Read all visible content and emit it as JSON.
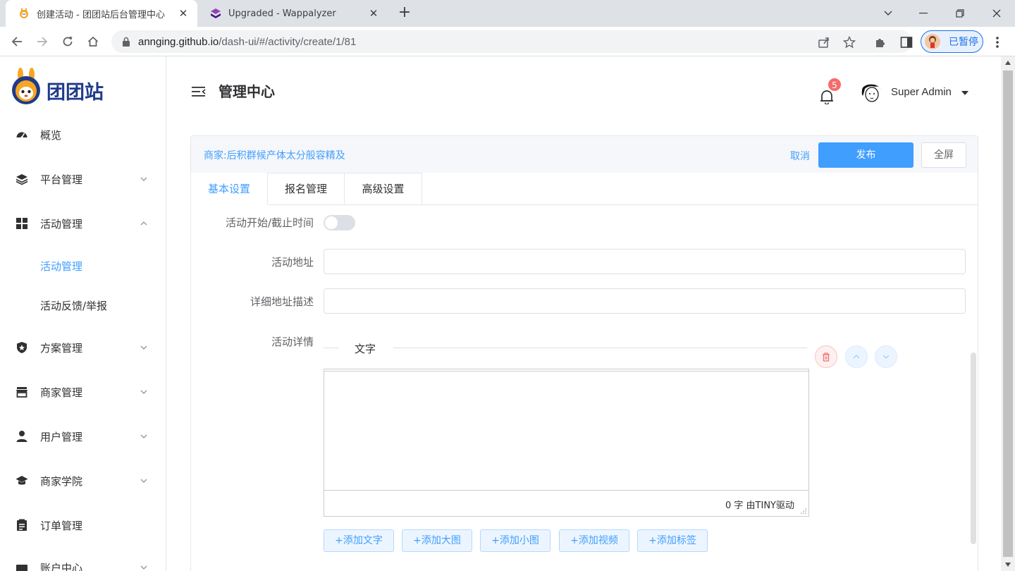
{
  "browser": {
    "tabs": [
      {
        "title": "创建活动 - 团团站后台管理中心",
        "active": true
      },
      {
        "title": "Upgraded - Wappalyzer",
        "active": false
      }
    ],
    "url_host": "annging.github.io",
    "url_path": "/dash-ui/#/activity/create/1/81",
    "profile_label": "已暂停",
    "accent": "#1a73e8"
  },
  "sidebar": {
    "logo_text": "团团站",
    "items": [
      {
        "label": "概览",
        "icon": "dashboard-icon",
        "expandable": false
      },
      {
        "label": "平台管理",
        "icon": "layers-icon",
        "expandable": true
      },
      {
        "label": "活动管理",
        "icon": "grid-icon",
        "expandable": true,
        "expanded": true
      },
      {
        "label": "活动管理",
        "sub": true,
        "active": true
      },
      {
        "label": "活动反馈/举报",
        "sub": true
      },
      {
        "label": "方案管理",
        "icon": "shield-icon",
        "expandable": true
      },
      {
        "label": "商家管理",
        "icon": "store-icon",
        "expandable": true
      },
      {
        "label": "用户管理",
        "icon": "user-icon",
        "expandable": true
      },
      {
        "label": "商家学院",
        "icon": "graduation-cap-icon",
        "expandable": true
      },
      {
        "label": "订单管理",
        "icon": "clipboard-icon",
        "expandable": false
      },
      {
        "label": "账户中心",
        "icon": "account-icon",
        "expandable": true
      }
    ]
  },
  "header": {
    "title": "管理中心",
    "notification_count": "5",
    "user_name": "Super Admin"
  },
  "card": {
    "merchant": "商家:后积群候产体太分般容精及",
    "cancel": "取消",
    "publish": "发布",
    "fullscreen": "全屏",
    "tabs": [
      "基本设置",
      "报名管理",
      "高级设置"
    ],
    "active_tab": 0
  },
  "form": {
    "time_label": "活动开始/截止时间",
    "time_switch_on": false,
    "address_label": "活动地址",
    "address_value": "",
    "detail_address_label": "详细地址描述",
    "detail_address_value": "",
    "details_label": "活动详情",
    "section_title": "文字",
    "editor_status": "0 字 由TINY驱动",
    "add_buttons": [
      "+添加文字",
      "+添加大图",
      "+添加小图",
      "+添加视频",
      "+添加标签"
    ]
  },
  "colors": {
    "primary": "#409eff",
    "danger": "#f56c6c"
  }
}
